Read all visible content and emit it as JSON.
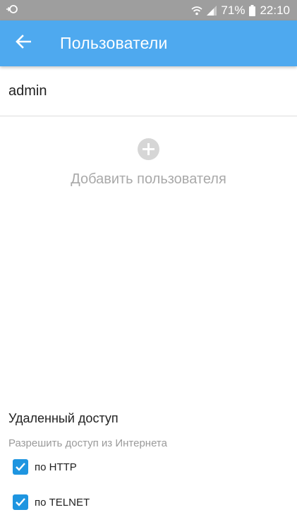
{
  "status_bar": {
    "battery": "71%",
    "time": "22:10",
    "icons": [
      "sync-icon",
      "wifi-icon",
      "signal-icon",
      "battery-icon"
    ]
  },
  "app_bar": {
    "title": "Пользователи",
    "back_icon": "arrow-left-icon",
    "color": "#4ea9ef"
  },
  "users": [
    {
      "name": "admin"
    }
  ],
  "add_user": {
    "label": "Добавить пользователя",
    "icon": "plus-circle-icon"
  },
  "remote_access": {
    "title": "Удаленный доступ",
    "subtitle": "Разрешить доступ из Интернета",
    "options": [
      {
        "label": "по HTTP",
        "checked": true
      },
      {
        "label": "по TELNET",
        "checked": true
      }
    ],
    "check_color": "#1e95e0"
  }
}
